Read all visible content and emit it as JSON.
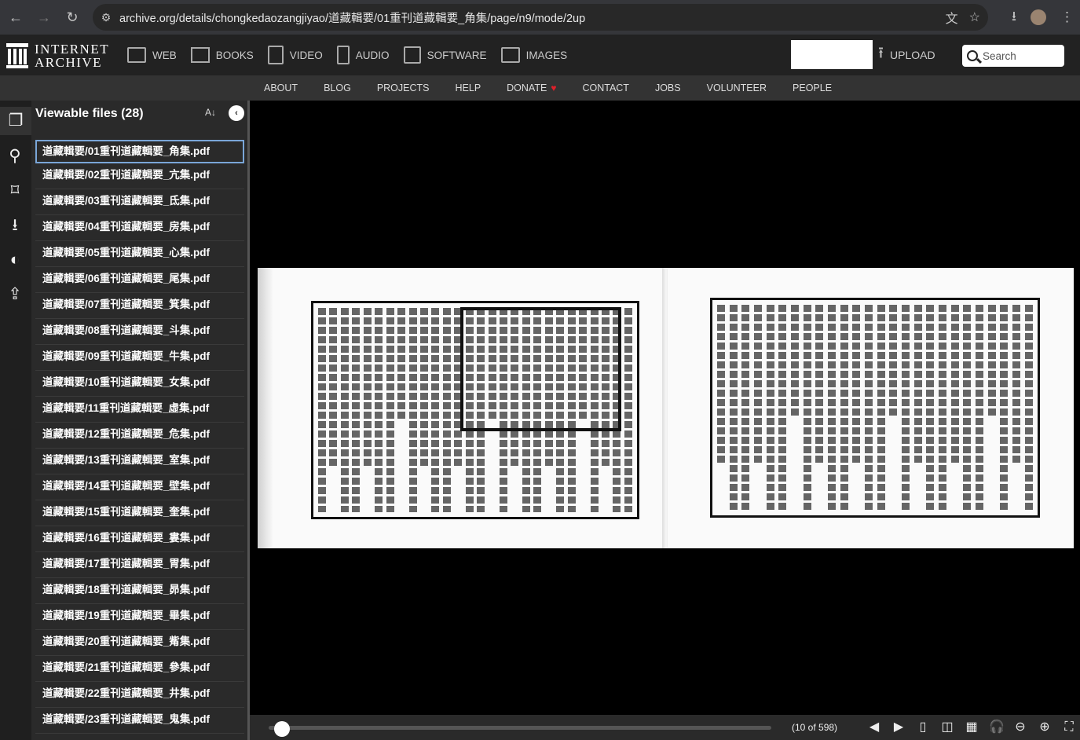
{
  "browser": {
    "url": "archive.org/details/chongkedaozangjiyao/道藏輯要/01重刊道藏輯要_角集/page/n9/mode/2up",
    "back_icon": "←",
    "forward_icon": "→",
    "reload_icon": "↻",
    "translate_icon": "文",
    "star_icon": "☆",
    "download_icon": "⭳",
    "menu_icon": "⋮"
  },
  "ia_header": {
    "logo_line1": "INTERNET",
    "logo_line2": "ARCHIVE",
    "menu": [
      {
        "label": "WEB"
      },
      {
        "label": "BOOKS"
      },
      {
        "label": "VIDEO"
      },
      {
        "label": "AUDIO"
      },
      {
        "label": "SOFTWARE"
      },
      {
        "label": "IMAGES"
      }
    ],
    "upload_label": "UPLOAD",
    "search_placeholder": "Search"
  },
  "sub_nav": [
    "ABOUT",
    "BLOG",
    "PROJECTS",
    "HELP",
    "DONATE",
    "CONTACT",
    "JOBS",
    "VOLUNTEER",
    "PEOPLE"
  ],
  "side_panel": {
    "title": "Viewable files (28)",
    "files": [
      "道藏輯要/01重刊道藏輯要_角集.pdf",
      "道藏輯要/02重刊道藏輯要_亢集.pdf",
      "道藏輯要/03重刊道藏輯要_氐集.pdf",
      "道藏輯要/04重刊道藏輯要_房集.pdf",
      "道藏輯要/05重刊道藏輯要_心集.pdf",
      "道藏輯要/06重刊道藏輯要_尾集.pdf",
      "道藏輯要/07重刊道藏輯要_箕集.pdf",
      "道藏輯要/08重刊道藏輯要_斗集.pdf",
      "道藏輯要/09重刊道藏輯要_牛集.pdf",
      "道藏輯要/10重刊道藏輯要_女集.pdf",
      "道藏輯要/11重刊道藏輯要_虛集.pdf",
      "道藏輯要/12重刊道藏輯要_危集.pdf",
      "道藏輯要/13重刊道藏輯要_室集.pdf",
      "道藏輯要/14重刊道藏輯要_壁集.pdf",
      "道藏輯要/15重刊道藏輯要_奎集.pdf",
      "道藏輯要/16重刊道藏輯要_婁集.pdf",
      "道藏輯要/17重刊道藏輯要_胃集.pdf",
      "道藏輯要/18重刊道藏輯要_昴集.pdf",
      "道藏輯要/19重刊道藏輯要_畢集.pdf",
      "道藏輯要/20重刊道藏輯要_觜集.pdf",
      "道藏輯要/21重刊道藏輯要_參集.pdf",
      "道藏輯要/22重刊道藏輯要_井集.pdf",
      "道藏輯要/23重刊道藏輯要_鬼集.pdf"
    ],
    "selected_index": 0
  },
  "viewer": {
    "page_count": "(10 of 598)",
    "scrub_position": 0.0167
  }
}
